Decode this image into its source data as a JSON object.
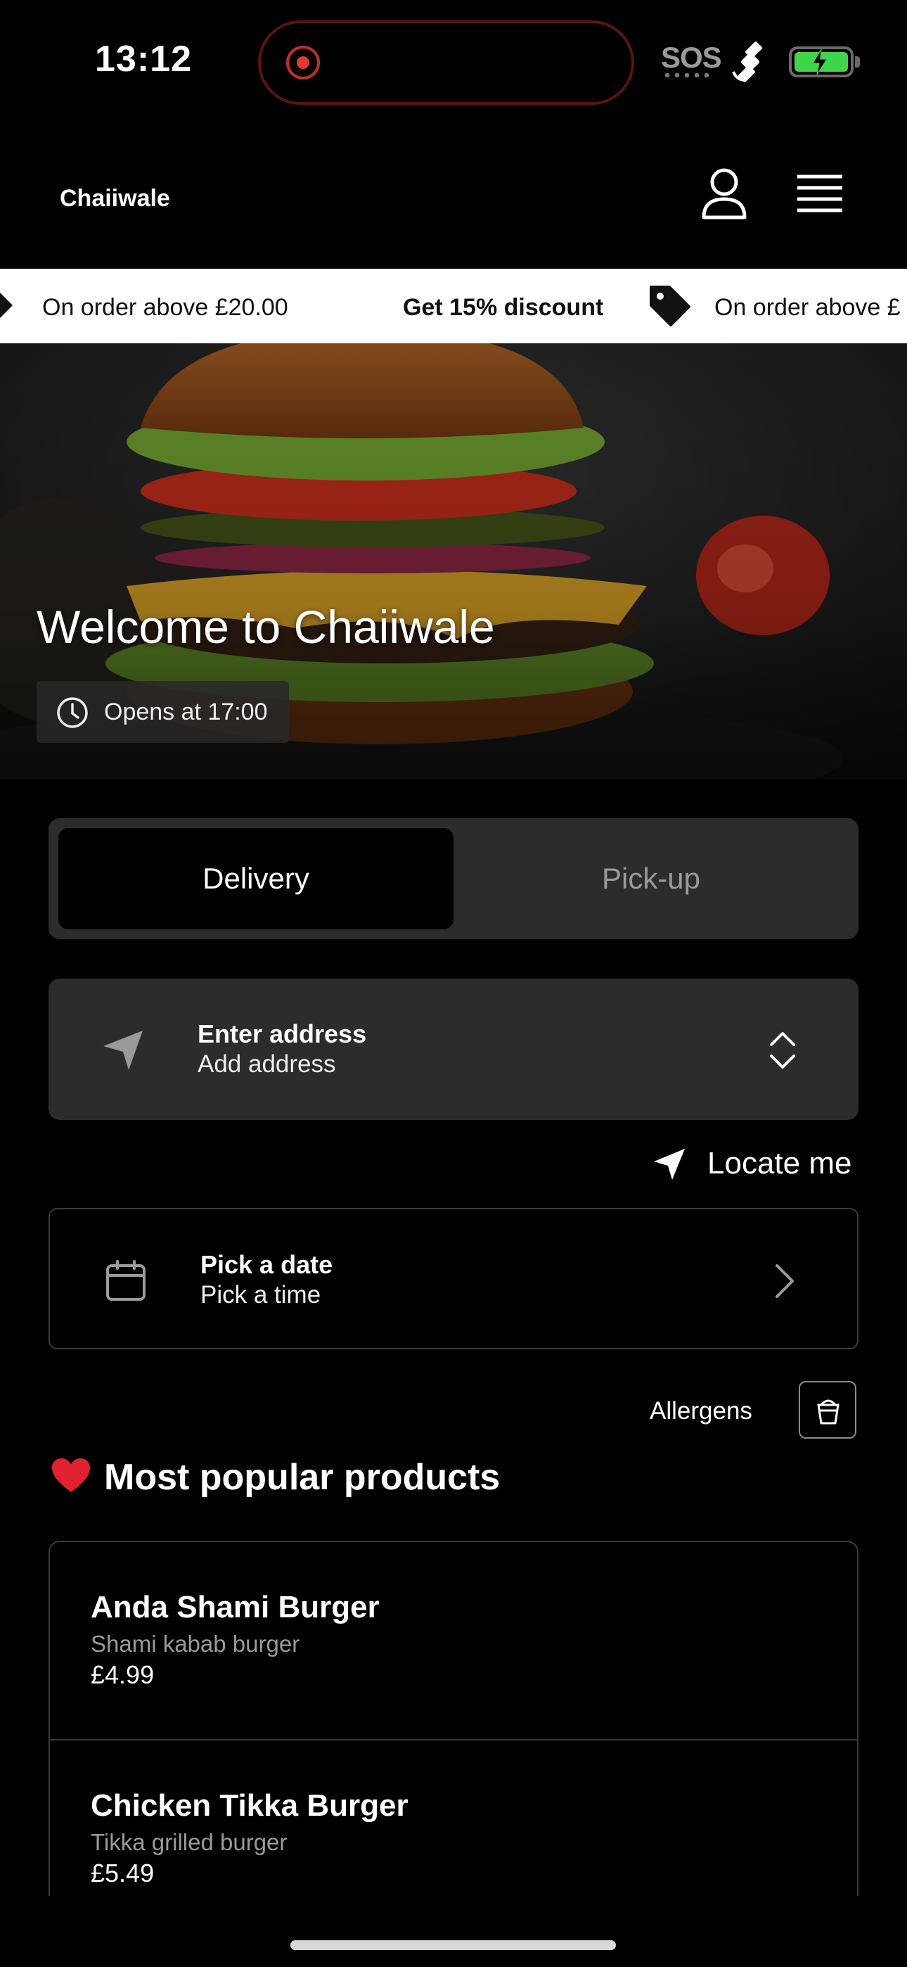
{
  "status_bar": {
    "time": "13:12",
    "sos_label": "SOS",
    "icons": [
      "record-indicator",
      "satellite-icon",
      "battery-charging-icon"
    ]
  },
  "header": {
    "brand": "Chaiiwale",
    "icons": [
      "user-icon",
      "menu-icon"
    ]
  },
  "promo": {
    "item1_text": "On order above £20.00",
    "item2_bold": "Get 15% discount",
    "item3_text": "On order above £"
  },
  "hero": {
    "title": "Welcome to Chaiiwale",
    "opens_text": "Opens at 17:00"
  },
  "order_mode": {
    "delivery_label": "Delivery",
    "pickup_label": "Pick-up",
    "selected": "Delivery"
  },
  "address": {
    "title": "Enter address",
    "subtitle": "Add address",
    "locate_label": "Locate me"
  },
  "schedule": {
    "title": "Pick a date",
    "subtitle": "Pick a time"
  },
  "allergens": {
    "label": "Allergens"
  },
  "popular": {
    "title": "Most popular products",
    "products": [
      {
        "name": "Anda Shami Burger",
        "description": "Shami kabab burger",
        "price": "£4.99"
      },
      {
        "name": "Chicken Tikka Burger",
        "description": "Tikka grilled burger",
        "price": "£5.49"
      }
    ]
  },
  "colors": {
    "background": "#000000",
    "card": "#2c2c2e",
    "battery": "#3fd54b",
    "record": "#e03a30",
    "heart": "#e0212f"
  }
}
